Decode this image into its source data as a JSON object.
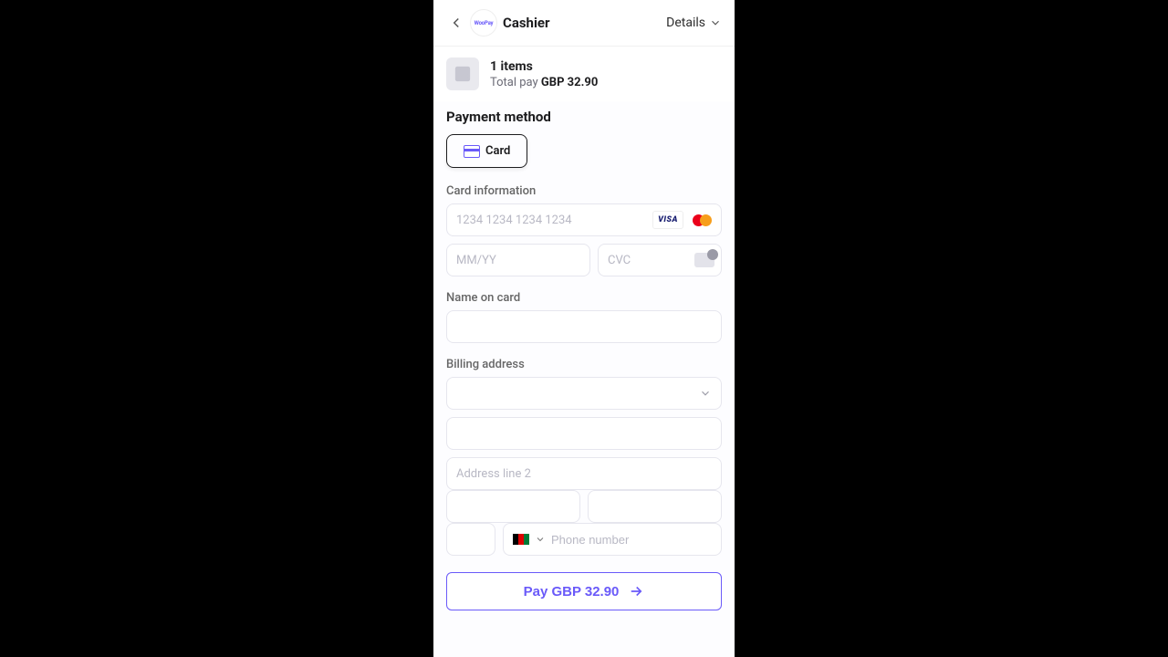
{
  "header": {
    "title": "Cashier",
    "logo_text": "WooPay",
    "details_label": "Details"
  },
  "summary": {
    "items_label": "1 items",
    "total_prefix": "Total pay ",
    "total_amount": "GBP 32.90"
  },
  "payment_method": {
    "section_title": "Payment method",
    "card_label": "Card"
  },
  "card_info": {
    "section_label": "Card information",
    "number_placeholder": "1234 1234 1234 1234",
    "expiry_placeholder": "MM/YY",
    "cvc_placeholder": "CVC"
  },
  "name": {
    "label": "Name on card",
    "value": ""
  },
  "billing": {
    "label": "Billing address",
    "country_selected": "",
    "address1_placeholder": "",
    "address2_placeholder": "Address line 2",
    "city_placeholder": "",
    "state_placeholder": "",
    "zip_placeholder": "",
    "phone_placeholder": "Phone number"
  },
  "pay_button": {
    "label": "Pay GBP 32.90"
  }
}
